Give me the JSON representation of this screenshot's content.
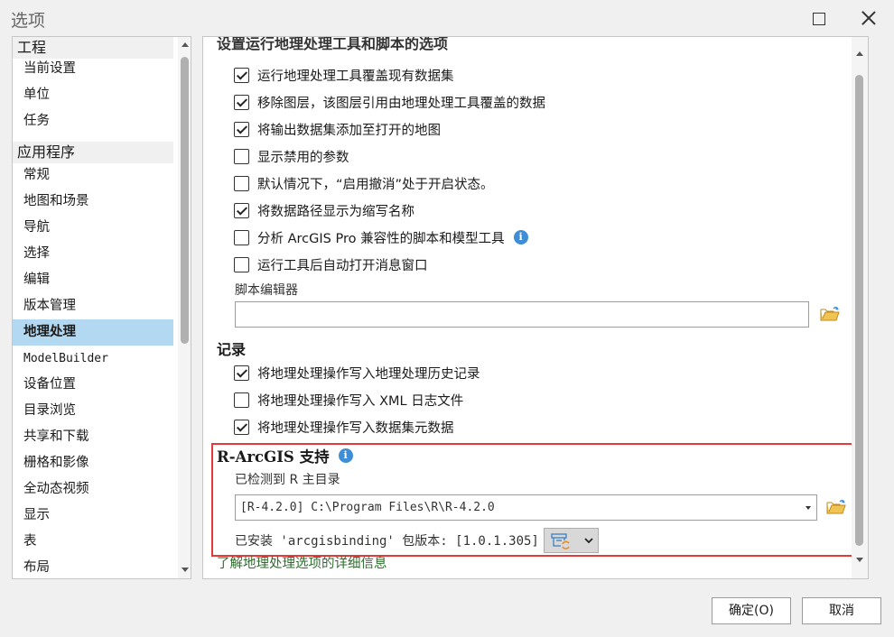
{
  "window": {
    "title": "选项"
  },
  "nav": {
    "sections": [
      {
        "label": "工程",
        "items": [
          "当前设置",
          "单位",
          "任务"
        ]
      },
      {
        "label": "应用程序",
        "items": [
          "常规",
          "地图和场景",
          "导航",
          "选择",
          "编辑",
          "版本管理",
          "地理处理",
          "ModelBuilder",
          "设备位置",
          "目录浏览",
          "共享和下载",
          "栅格和影像",
          "全动态视频",
          "显示",
          "表",
          "布局"
        ]
      }
    ],
    "selected": "地理处理"
  },
  "content": {
    "cut_heading": "设置运行地理处理工具和脚本的选项",
    "options": [
      {
        "label": "运行地理处理工具覆盖现有数据集",
        "checked": true
      },
      {
        "label": "移除图层，该图层引用由地理处理工具覆盖的数据",
        "checked": true
      },
      {
        "label": "将输出数据集添加至打开的地图",
        "checked": true
      },
      {
        "label": "显示禁用的参数",
        "checked": false
      },
      {
        "label": "默认情况下，“启用撤消”处于开启状态。",
        "checked": false
      },
      {
        "label": "将数据路径显示为缩写名称",
        "checked": true
      },
      {
        "label": "分析 ArcGIS Pro 兼容性的脚本和模型工具",
        "checked": false,
        "info": true
      },
      {
        "label": "运行工具后自动打开消息窗口",
        "checked": false
      }
    ],
    "script_editor": {
      "label": "脚本编辑器",
      "value": ""
    },
    "logging": {
      "title": "记录",
      "options": [
        {
          "label": "将地理处理操作写入地理处理历史记录",
          "checked": true
        },
        {
          "label": "将地理处理操作写入 XML 日志文件",
          "checked": false
        },
        {
          "label": "将地理处理操作写入数据集元数据",
          "checked": true
        }
      ]
    },
    "r_support": {
      "title": "R-ArcGIS 支持",
      "detected_label": "已检测到 R 主目录",
      "r_home": "[R-4.2.0] C:\\Program Files\\R\\R-4.2.0",
      "pkg_text": "已安装 'arcgisbinding' 包版本: [1.0.1.305]"
    },
    "learn_more": "了解地理处理选项的详细信息"
  },
  "buttons": {
    "ok": "确定(O)",
    "cancel": "取消"
  },
  "colors": {
    "selected_bg": "#b3d9f2",
    "highlight_border": "#e63a3a",
    "info_blue": "#3d8ed6"
  }
}
